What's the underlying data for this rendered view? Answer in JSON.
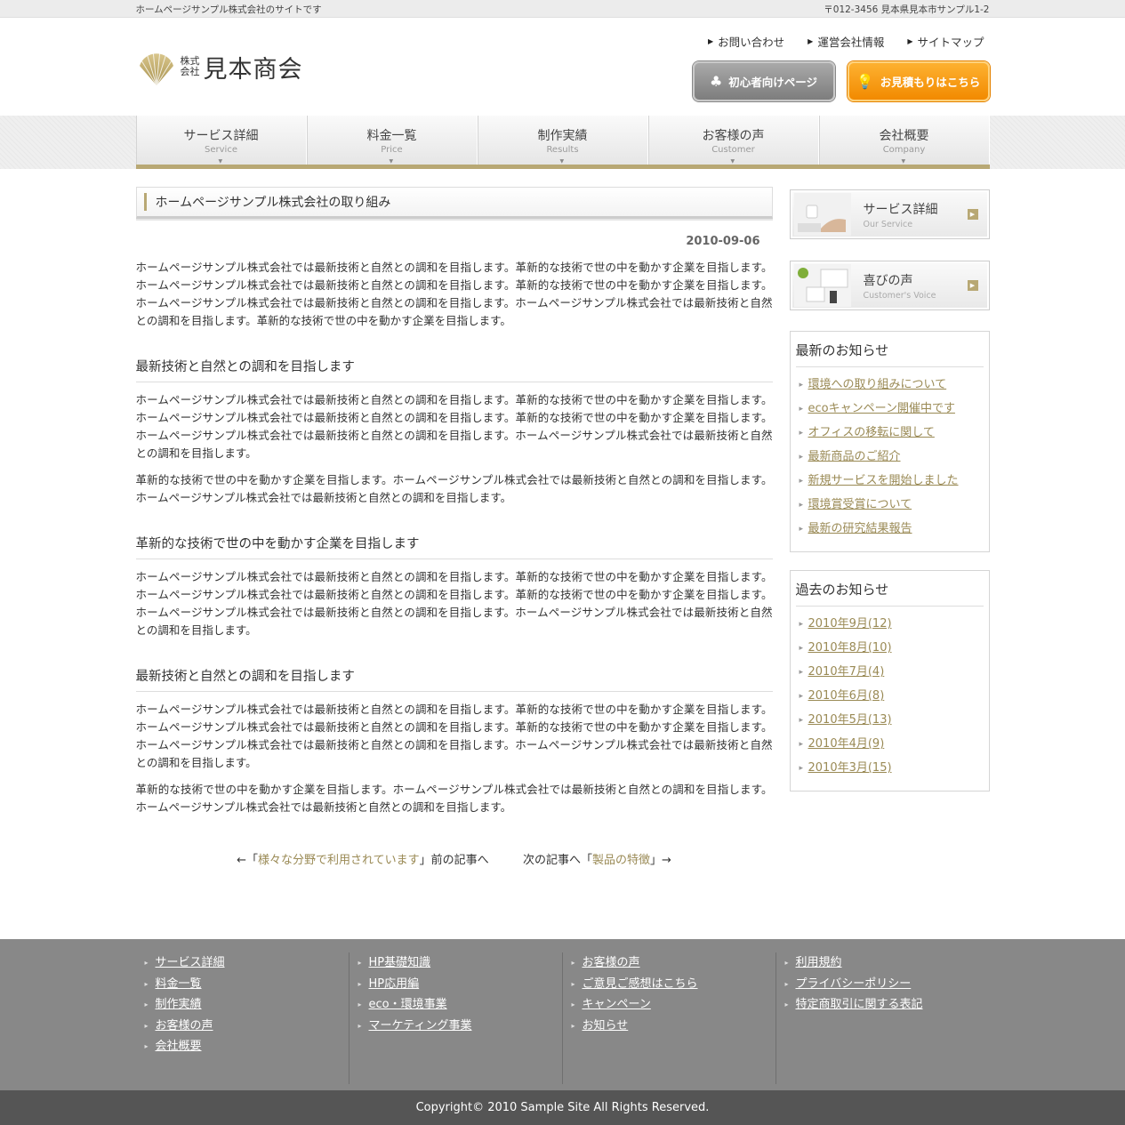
{
  "topbar": {
    "tagline": "ホームページサンプル株式会社のサイトです",
    "address": "〒012-3456 見本県見本市サンプル1-2"
  },
  "header": {
    "logo_small": "株式会社",
    "logo_big": "見本商会",
    "links": [
      "お問い合わせ",
      "運営会社情報",
      "サイトマップ"
    ],
    "btn_beginner": "初心者向けページ",
    "btn_estimate": "お見積もりはこちら"
  },
  "nav": [
    {
      "jp": "サービス詳細",
      "en": "Service"
    },
    {
      "jp": "料金一覧",
      "en": "Price"
    },
    {
      "jp": "制作実績",
      "en": "Results"
    },
    {
      "jp": "お客様の声",
      "en": "Customer"
    },
    {
      "jp": "会社概要",
      "en": "Company"
    }
  ],
  "article": {
    "title": "ホームページサンプル株式会社の取り組み",
    "date": "2010-09-06",
    "intro": "ホームページサンプル株式会社では最新技術と自然との調和を目指します。革新的な技術で世の中を動かす企業を目指します。ホームページサンプル株式会社では最新技術と自然との調和を目指します。革新的な技術で世の中を動かす企業を目指します。ホームページサンプル株式会社では最新技術と自然との調和を目指します。ホームページサンプル株式会社では最新技術と自然との調和を目指します。革新的な技術で世の中を動かす企業を目指します。",
    "s1_heading": "最新技術と自然との調和を目指します",
    "s1_p1": "ホームページサンプル株式会社では最新技術と自然との調和を目指します。革新的な技術で世の中を動かす企業を目指します。ホームページサンプル株式会社では最新技術と自然との調和を目指します。革新的な技術で世の中を動かす企業を目指します。ホームページサンプル株式会社では最新技術と自然との調和を目指します。ホームページサンプル株式会社では最新技術と自然との調和を目指します。",
    "s1_p2": "革新的な技術で世の中を動かす企業を目指します。ホームページサンプル株式会社では最新技術と自然との調和を目指します。ホームページサンプル株式会社では最新技術と自然との調和を目指します。",
    "s2_heading": "革新的な技術で世の中を動かす企業を目指します",
    "s2_p1": "ホームページサンプル株式会社では最新技術と自然との調和を目指します。革新的な技術で世の中を動かす企業を目指します。ホームページサンプル株式会社では最新技術と自然との調和を目指します。革新的な技術で世の中を動かす企業を目指します。ホームページサンプル株式会社では最新技術と自然との調和を目指します。ホームページサンプル株式会社では最新技術と自然との調和を目指します。",
    "s3_heading": "最新技術と自然との調和を目指します",
    "s3_p1": "ホームページサンプル株式会社では最新技術と自然との調和を目指します。革新的な技術で世の中を動かす企業を目指します。ホームページサンプル株式会社では最新技術と自然との調和を目指します。革新的な技術で世の中を動かす企業を目指します。ホームページサンプル株式会社では最新技術と自然との調和を目指します。ホームページサンプル株式会社では最新技術と自然との調和を目指します。",
    "s3_p2": "革新的な技術で世の中を動かす企業を目指します。ホームページサンプル株式会社では最新技術と自然との調和を目指します。ホームページサンプル株式会社では最新技術と自然との調和を目指します。"
  },
  "pager": {
    "prev_prefix": "←「",
    "prev_link": "様々な分野で利用されています",
    "prev_suffix": "」前の記事へ",
    "next_prefix": "次の記事へ「",
    "next_link": "製品の特徴",
    "next_suffix": "」→"
  },
  "side": {
    "banner1_jp": "サービス詳細",
    "banner1_en": "Our Service",
    "banner2_jp": "喜びの声",
    "banner2_en": "Customer's Voice",
    "news_title": "最新のお知らせ",
    "news": [
      "環境への取り組みについて",
      "ecoキャンペーン開催中です",
      "オフィスの移転に関して",
      "最新商品のご紹介",
      "新規サービスを開始しました",
      "環境賞受賞について",
      "最新の研究結果報告"
    ],
    "archive_title": "過去のお知らせ",
    "archive": [
      "2010年9月(12)",
      "2010年8月(10)",
      "2010年7月(4)",
      "2010年6月(8)",
      "2010年5月(13)",
      "2010年4月(9)",
      "2010年3月(15)"
    ]
  },
  "footer": {
    "col1": [
      "サービス詳細",
      "料金一覧",
      "制作実績",
      "お客様の声",
      "会社概要"
    ],
    "col2": [
      "HP基礎知識",
      "HP応用編",
      "eco・環境事業",
      "マーケティング事業"
    ],
    "col3": [
      "お客様の声",
      "ご意見ご感想はこちら",
      "キャンペーン",
      "お知らせ"
    ],
    "col4": [
      "利用規約",
      "プライバシーポリシー",
      "特定商取引に関する表記"
    ],
    "copyright": "Copyright© 2010 Sample Site All Rights Reserved."
  },
  "colors": {
    "accent": "#b8a874",
    "orange": "#f29b10",
    "footer": "#888888"
  }
}
